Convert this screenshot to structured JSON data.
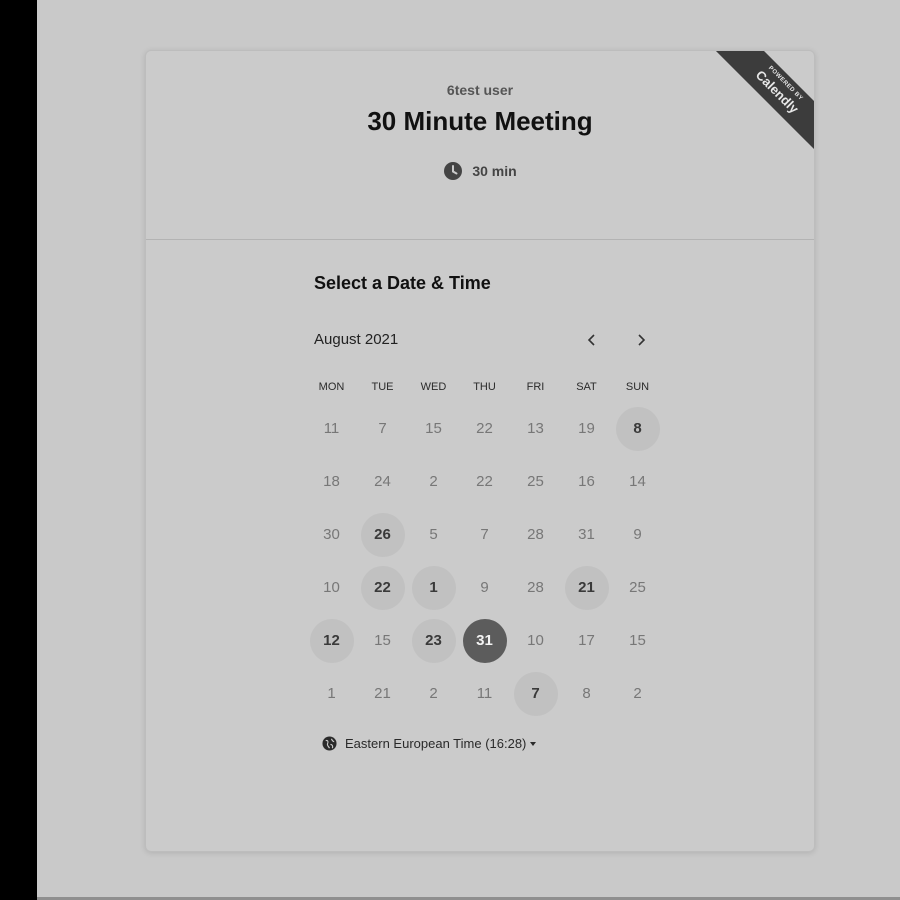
{
  "event": {
    "owner": "6test user",
    "title": "30 Minute Meeting",
    "duration": "30 min"
  },
  "badge": {
    "top": "POWERED BY",
    "brand": "Calendly"
  },
  "calendar": {
    "heading": "Select a Date & Time",
    "month": "August 2021",
    "weekdays": [
      "MON",
      "TUE",
      "WED",
      "THU",
      "FRI",
      "SAT",
      "SUN"
    ],
    "weeks": [
      [
        {
          "n": "11",
          "s": "u"
        },
        {
          "n": "7",
          "s": "u"
        },
        {
          "n": "15",
          "s": "u"
        },
        {
          "n": "22",
          "s": "u"
        },
        {
          "n": "13",
          "s": "u"
        },
        {
          "n": "19",
          "s": "u"
        },
        {
          "n": "8",
          "s": "a"
        }
      ],
      [
        {
          "n": "18",
          "s": "u"
        },
        {
          "n": "24",
          "s": "u"
        },
        {
          "n": "2",
          "s": "u"
        },
        {
          "n": "22",
          "s": "u"
        },
        {
          "n": "25",
          "s": "u"
        },
        {
          "n": "16",
          "s": "u"
        },
        {
          "n": "14",
          "s": "u"
        }
      ],
      [
        {
          "n": "30",
          "s": "u"
        },
        {
          "n": "26",
          "s": "a"
        },
        {
          "n": "5",
          "s": "u"
        },
        {
          "n": "7",
          "s": "u"
        },
        {
          "n": "28",
          "s": "u"
        },
        {
          "n": "31",
          "s": "u"
        },
        {
          "n": "9",
          "s": "u"
        }
      ],
      [
        {
          "n": "10",
          "s": "u"
        },
        {
          "n": "22",
          "s": "a"
        },
        {
          "n": "1",
          "s": "a"
        },
        {
          "n": "9",
          "s": "u"
        },
        {
          "n": "28",
          "s": "u"
        },
        {
          "n": "21",
          "s": "a"
        },
        {
          "n": "25",
          "s": "u"
        }
      ],
      [
        {
          "n": "12",
          "s": "a"
        },
        {
          "n": "15",
          "s": "u"
        },
        {
          "n": "23",
          "s": "a"
        },
        {
          "n": "31",
          "s": "s"
        },
        {
          "n": "10",
          "s": "u"
        },
        {
          "n": "17",
          "s": "u"
        },
        {
          "n": "15",
          "s": "u"
        }
      ],
      [
        {
          "n": "1",
          "s": "u"
        },
        {
          "n": "21",
          "s": "u"
        },
        {
          "n": "2",
          "s": "u"
        },
        {
          "n": "11",
          "s": "u"
        },
        {
          "n": "7",
          "s": "a"
        },
        {
          "n": "8",
          "s": "u"
        },
        {
          "n": "2",
          "s": "u"
        }
      ]
    ],
    "timezone": "Eastern European Time (16:28)"
  },
  "icons": {
    "clock": "clock-icon",
    "globe": "globe-icon",
    "prev": "chevron-left-icon",
    "next": "chevron-right-icon",
    "caret": "caret-down-icon"
  },
  "colors": {
    "selected_day": "#5c5c5c",
    "available_day": "#c1c1c1",
    "ribbon": "#3c3c3c"
  }
}
